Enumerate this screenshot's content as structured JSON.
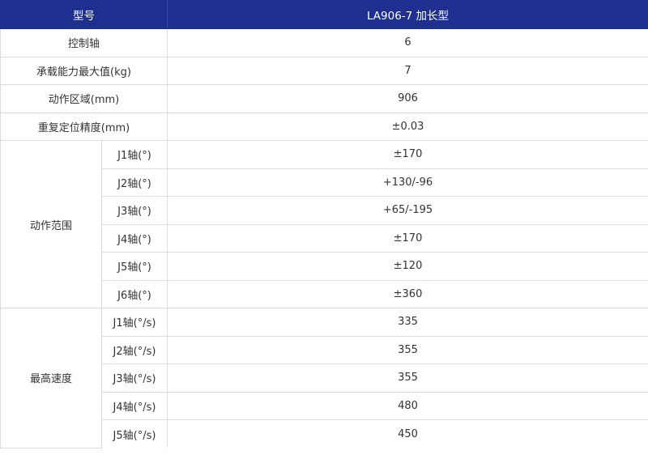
{
  "header": {
    "col1": "型号",
    "col2": "LA906-7 加长型"
  },
  "rows": [
    {
      "label": "控制轴",
      "value": "6"
    },
    {
      "label": "承载能力最大值(kg)",
      "value": "7"
    },
    {
      "label": "动作区域(mm)",
      "value": "906"
    },
    {
      "label": "重复定位精度(mm)",
      "value": "±0.03"
    }
  ],
  "groups": [
    {
      "label": "动作范围",
      "items": [
        {
          "label": "J1轴(°)",
          "value": "±170"
        },
        {
          "label": "J2轴(°)",
          "value": "+130/-96"
        },
        {
          "label": "J3轴(°)",
          "value": "+65/-195"
        },
        {
          "label": "J4轴(°)",
          "value": "±170"
        },
        {
          "label": "J5轴(°)",
          "value": "±120"
        },
        {
          "label": "J6轴(°)",
          "value": "±360"
        }
      ]
    },
    {
      "label": "最高速度",
      "items": [
        {
          "label": "J1轴(°/s)",
          "value": "335"
        },
        {
          "label": "J2轴(°/s)",
          "value": "355"
        },
        {
          "label": "J3轴(°/s)",
          "value": "355"
        },
        {
          "label": "J4轴(°/s)",
          "value": "480"
        },
        {
          "label": "J5轴(°/s)",
          "value": "450"
        }
      ]
    }
  ],
  "colors": {
    "header_bg": "#1e2f8f",
    "border": "#dcdcdc",
    "text": "#333333"
  }
}
